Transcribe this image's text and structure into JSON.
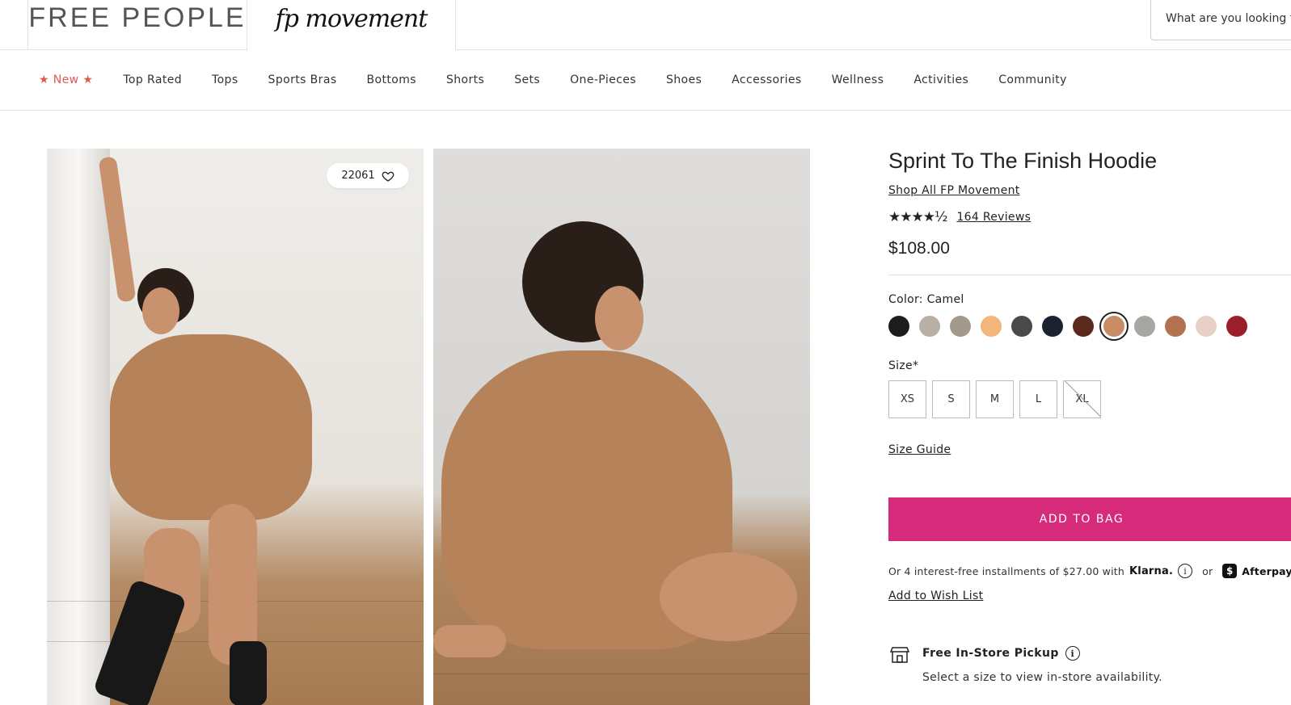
{
  "header": {
    "brand_primary": "FREE PEOPLE",
    "brand_secondary": "fp movement",
    "search_placeholder": "What are you looking for?"
  },
  "nav": {
    "items": [
      {
        "label": "★ New ★"
      },
      {
        "label": "Top Rated"
      },
      {
        "label": "Tops"
      },
      {
        "label": "Sports Bras"
      },
      {
        "label": "Bottoms"
      },
      {
        "label": "Shorts"
      },
      {
        "label": "Sets"
      },
      {
        "label": "One-Pieces"
      },
      {
        "label": "Shoes"
      },
      {
        "label": "Accessories"
      },
      {
        "label": "Wellness"
      },
      {
        "label": "Activities"
      },
      {
        "label": "Community"
      }
    ]
  },
  "gallery": {
    "favorites_count": "22061"
  },
  "product": {
    "title": "Sprint To The Finish Hoodie",
    "shop_link": "Shop All FP Movement",
    "rating_stars": "★★★★½",
    "rating": 4.5,
    "reviews": "164 Reviews",
    "price": "$108.00",
    "color_label": "Color: Camel",
    "swatches": [
      {
        "name": "black",
        "color": "#1c1c1c"
      },
      {
        "name": "stone",
        "color": "#b9b0a5"
      },
      {
        "name": "taupe",
        "color": "#a39a8b"
      },
      {
        "name": "peach",
        "color": "#f3b57a"
      },
      {
        "name": "charcoal",
        "color": "#4a4a4c"
      },
      {
        "name": "navy",
        "color": "#1d2230"
      },
      {
        "name": "chocolate",
        "color": "#5b2a1c"
      },
      {
        "name": "camel",
        "color": "#c98d66",
        "selected": true
      },
      {
        "name": "heather grey",
        "color": "#a6a6a2"
      },
      {
        "name": "rust tie dye",
        "color": "#b37350"
      },
      {
        "name": "pink tie dye",
        "color": "#e8cfc8"
      },
      {
        "name": "cranberry",
        "color": "#9b1f2b"
      }
    ],
    "size_label": "Size*",
    "sizes": [
      {
        "label": "XS",
        "available": true
      },
      {
        "label": "S",
        "available": true
      },
      {
        "label": "M",
        "available": true
      },
      {
        "label": "L",
        "available": true
      },
      {
        "label": "XL",
        "available": false
      }
    ],
    "size_guide": "Size Guide",
    "add_to_bag": "ADD TO BAG",
    "installments_text": "Or 4 interest-free installments of $27.00 with",
    "klarna": "Klarna.",
    "or": "or",
    "afterpay": "Afterpay",
    "wish_list": "Add to Wish List",
    "pickup_title": "Free In-Store Pickup",
    "pickup_sub": "Select a size to view in-store availability."
  },
  "icons": {
    "heart": "heart-icon",
    "info": "info-icon",
    "store": "store-icon",
    "afterpay": "afterpay-icon"
  },
  "colors": {
    "accent": "#d62a7a",
    "new_label": "#e0594f"
  }
}
